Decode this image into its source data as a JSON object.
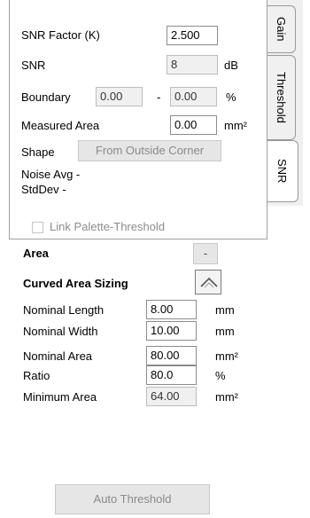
{
  "tabs": [
    {
      "label": "Gain"
    },
    {
      "label": "Threshold"
    },
    {
      "label": "SNR"
    }
  ],
  "snr_panel": {
    "snr_factor_label": "SNR Factor (K)",
    "snr_factor_value": "2.500",
    "snr_label": "SNR",
    "snr_value": "8",
    "snr_unit": "dB",
    "boundary_label": "Boundary",
    "boundary_min": "0.00",
    "boundary_sep": "-",
    "boundary_max": "0.00",
    "boundary_unit": "%",
    "measured_area_label": "Measured Area",
    "measured_area_value": "0.00",
    "measured_area_unit": "mm²",
    "shape_label": "Shape",
    "shape_value": "From Outside Corner",
    "noise_avg_label": "Noise Avg -",
    "stddev_label": "StdDev -",
    "link_palette_label": "Link Palette-Threshold",
    "link_palette_checked": false,
    "area_label": "Area",
    "area_button": "-",
    "curved_area_label": "Curved Area Sizing"
  },
  "nominal": {
    "length_label": "Nominal Length",
    "length_value": "8.00",
    "length_unit": "mm",
    "width_label": "Nominal Width",
    "width_value": "10.00",
    "width_unit": "mm",
    "area_label": "Nominal Area",
    "area_value": "80.00",
    "area_unit": "mm²",
    "ratio_label": "Ratio",
    "ratio_value": "80.0",
    "ratio_unit": "%",
    "min_area_label": "Minimum Area",
    "min_area_value": "64.00",
    "min_area_unit": "mm²"
  },
  "auto_threshold_button": "Auto Threshold",
  "icons": {
    "curved_toggle": "chevron-up-icon"
  }
}
